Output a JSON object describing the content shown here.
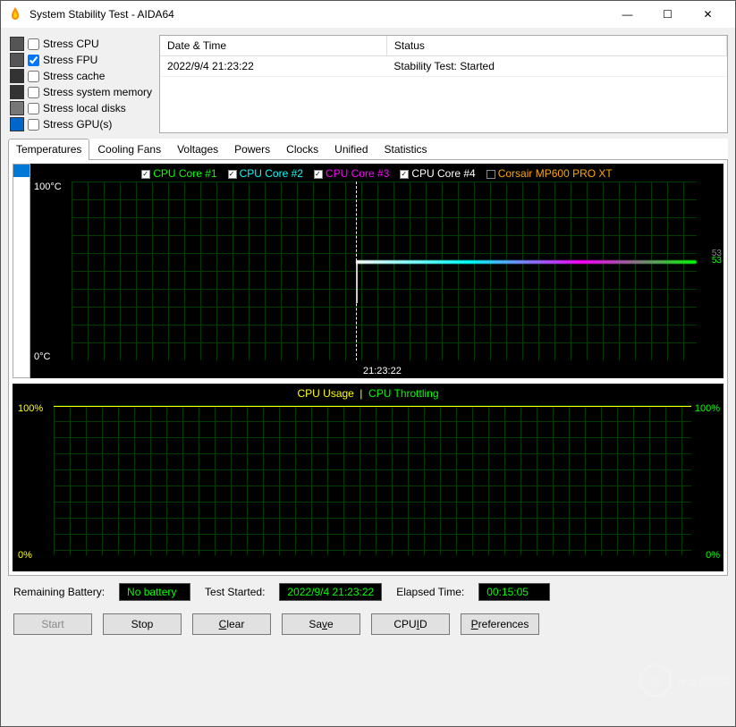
{
  "window": {
    "title": "System Stability Test - AIDA64",
    "minimize": "—",
    "maximize": "☐",
    "close": "✕"
  },
  "stress": [
    {
      "label": "Stress CPU",
      "checked": false,
      "icon": "cpu"
    },
    {
      "label": "Stress FPU",
      "checked": true,
      "icon": "fpu"
    },
    {
      "label": "Stress cache",
      "checked": false,
      "icon": "cache"
    },
    {
      "label": "Stress system memory",
      "checked": false,
      "icon": "ram"
    },
    {
      "label": "Stress local disks",
      "checked": false,
      "icon": "disk"
    },
    {
      "label": "Stress GPU(s)",
      "checked": false,
      "icon": "gpu"
    }
  ],
  "log": {
    "headers": [
      "Date & Time",
      "Status"
    ],
    "rows": [
      {
        "datetime": "2022/9/4 21:23:22",
        "status": "Stability Test: Started"
      }
    ]
  },
  "tabs": [
    "Temperatures",
    "Cooling Fans",
    "Voltages",
    "Powers",
    "Clocks",
    "Unified",
    "Statistics"
  ],
  "active_tab": 0,
  "chart_data": [
    {
      "type": "line",
      "title": "",
      "ylabel_top": "100°C",
      "ylabel_bot": "0°C",
      "ylim": [
        0,
        100
      ],
      "xmarker": "21:23:22",
      "series": [
        {
          "name": "CPU Core #1",
          "color": "#00ff00",
          "checked": true,
          "end_value": 53
        },
        {
          "name": "CPU Core #2",
          "color": "#00ffff",
          "checked": true,
          "end_value": 53
        },
        {
          "name": "CPU Core #3",
          "color": "#ff00ff",
          "checked": true,
          "end_value": 53
        },
        {
          "name": "CPU Core #4",
          "color": "#ffffff",
          "checked": true,
          "end_value": 53
        },
        {
          "name": "Corsair MP600 PRO XT",
          "color": "#ffa500",
          "checked": false,
          "end_value": null
        }
      ],
      "note": "Temperatures rise steeply at 21:23:22 from idle to ~50-54°C and hold roughly flat afterward."
    },
    {
      "type": "line",
      "title_a": "CPU Usage",
      "title_sep": "|",
      "title_b": "CPU Throttling",
      "left_axis": {
        "top": "100%",
        "bot": "0%",
        "lim": [
          0,
          100
        ]
      },
      "right_axis": {
        "top": "100%",
        "bot": "0%",
        "lim": [
          0,
          100
        ]
      },
      "series": [
        {
          "name": "CPU Usage",
          "color": "#ffff00",
          "value": 100
        },
        {
          "name": "CPU Throttling",
          "color": "#00ff00",
          "value": 0
        }
      ],
      "note": "CPU usage pinned at 100% across the window; throttling at 0%."
    }
  ],
  "status": {
    "battery_label": "Remaining Battery:",
    "battery_value": "No battery",
    "started_label": "Test Started:",
    "started_value": "2022/9/4 21:23:22",
    "elapsed_label": "Elapsed Time:",
    "elapsed_value": "00:15:05"
  },
  "buttons": {
    "start": "Start",
    "stop": "Stop",
    "clear": "Clear",
    "save": "Save",
    "cpuid": "CPUID",
    "preferences": "Preferences"
  },
  "watermark": "什么值得买"
}
